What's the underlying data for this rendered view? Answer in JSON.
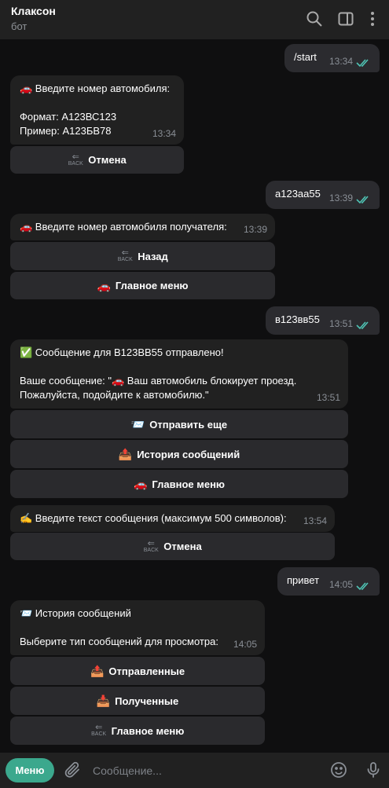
{
  "header": {
    "title": "Клаксон",
    "subtitle": "бот",
    "icons": [
      "search-icon",
      "sidebar-toggle-icon",
      "more-vertical-icon"
    ]
  },
  "messages": [
    {
      "dir": "out",
      "text": "/start",
      "time": "13:34"
    },
    {
      "dir": "in",
      "line1": "🚗 Введите номер автомобиля:",
      "line2": "Формат: А123ВС123",
      "line3": "Пример: А123БВ78",
      "time": "13:34",
      "buttons": [
        {
          "icon": "back",
          "label": "Отмена"
        }
      ]
    },
    {
      "dir": "out",
      "text": "а123аа55",
      "time": "13:39"
    },
    {
      "dir": "in",
      "line1": "🚗 Введите номер автомобиля получателя:",
      "time": "13:39",
      "buttons": [
        {
          "icon": "back",
          "label": "Назад"
        },
        {
          "icon": "🚗",
          "label": "Главное меню"
        }
      ]
    },
    {
      "dir": "out",
      "text": "в123вв55",
      "time": "13:51"
    },
    {
      "dir": "in",
      "line1": "✅ Сообщение для В123ВВ55 отправлено!",
      "line2": "Ваше сообщение: \"🚗 Ваш автомобиль блокирует проезд.",
      "line3": "Пожалуйста, подойдите к автомобилю.\"",
      "time": "13:51",
      "buttons": [
        {
          "icon": "📨",
          "label": "Отправить еще"
        },
        {
          "icon": "📤",
          "label": "История сообщений"
        },
        {
          "icon": "🚗",
          "label": "Главное меню"
        }
      ]
    },
    {
      "dir": "in",
      "line1": "✍️ Введите текст сообщения (максимум 500 символов):",
      "time": "13:54",
      "buttons": [
        {
          "icon": "back",
          "label": "Отмена"
        }
      ]
    },
    {
      "dir": "out",
      "text": "привет",
      "time": "14:05"
    },
    {
      "dir": "in",
      "line1": "📨 История сообщений",
      "line2": "Выберите тип сообщений для просмотра:",
      "time": "14:05",
      "buttons": [
        {
          "icon": "📤",
          "label": "Отправленные"
        },
        {
          "icon": "📥",
          "label": "Полученные"
        },
        {
          "icon": "back",
          "label": "Главное меню"
        }
      ]
    }
  ],
  "back_glyph": {
    "arrow": "⇐",
    "text": "BACK"
  },
  "bottom": {
    "menu_label": "Меню",
    "placeholder": "Сообщение...",
    "icons": [
      "attach-icon",
      "emoji-icon",
      "microphone-icon"
    ]
  },
  "colors": {
    "accent": "#3ba88d",
    "check": "#4fc3b4",
    "bubble": "#212121",
    "button": "#2a2a2d"
  }
}
